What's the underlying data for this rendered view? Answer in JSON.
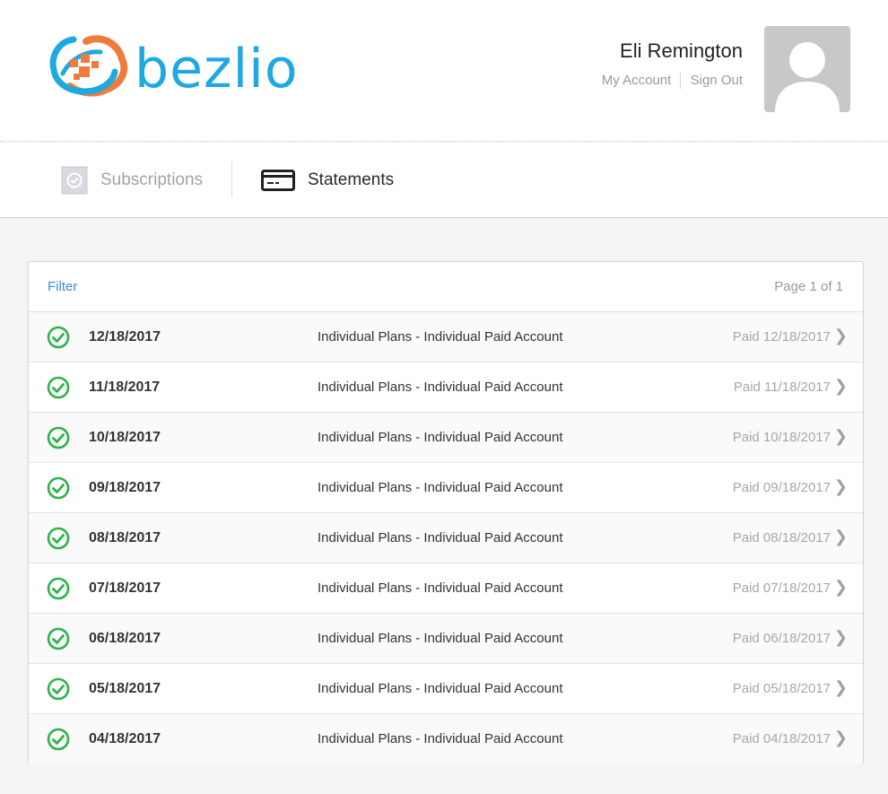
{
  "brand": {
    "name": "bezlio"
  },
  "user": {
    "name": "Eli Remington",
    "my_account": "My Account",
    "sign_out": "Sign Out"
  },
  "tabs": [
    {
      "label": "Subscriptions",
      "icon": "check-badge-icon",
      "active": false
    },
    {
      "label": "Statements",
      "icon": "card-icon",
      "active": true
    }
  ],
  "statements": {
    "filter_label": "Filter",
    "pager": "Page 1 of 1",
    "rows": [
      {
        "date": "12/18/2017",
        "description": "Individual Plans - Individual Paid Account",
        "status": "Paid 12/18/2017"
      },
      {
        "date": "11/18/2017",
        "description": "Individual Plans - Individual Paid Account",
        "status": "Paid 11/18/2017"
      },
      {
        "date": "10/18/2017",
        "description": "Individual Plans - Individual Paid Account",
        "status": "Paid 10/18/2017"
      },
      {
        "date": "09/18/2017",
        "description": "Individual Plans - Individual Paid Account",
        "status": "Paid 09/18/2017"
      },
      {
        "date": "08/18/2017",
        "description": "Individual Plans - Individual Paid Account",
        "status": "Paid 08/18/2017"
      },
      {
        "date": "07/18/2017",
        "description": "Individual Plans - Individual Paid Account",
        "status": "Paid 07/18/2017"
      },
      {
        "date": "06/18/2017",
        "description": "Individual Plans - Individual Paid Account",
        "status": "Paid 06/18/2017"
      },
      {
        "date": "05/18/2017",
        "description": "Individual Plans - Individual Paid Account",
        "status": "Paid 05/18/2017"
      },
      {
        "date": "04/18/2017",
        "description": "Individual Plans - Individual Paid Account",
        "status": "Paid 04/18/2017"
      }
    ]
  },
  "colors": {
    "brand_blue": "#1ea9e1",
    "brand_orange": "#f07c3b",
    "paid_green": "#2cb34a",
    "link_blue": "#3a8dd1"
  }
}
